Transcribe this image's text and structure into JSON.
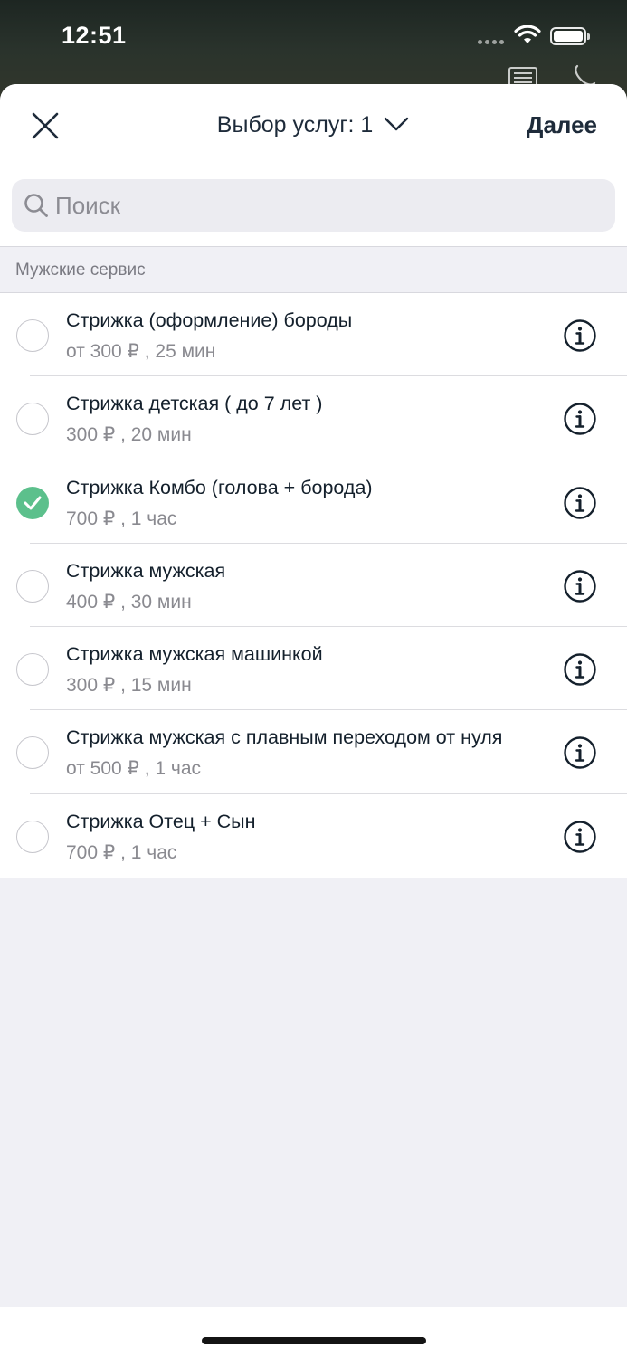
{
  "status_bar": {
    "time": "12:51"
  },
  "nav": {
    "title": "Выбор услуг: 1",
    "next_label": "Далее"
  },
  "search": {
    "placeholder": "Поиск",
    "value": ""
  },
  "section": {
    "title": "Мужские сервис"
  },
  "services": [
    {
      "name": "Стрижка (оформление) бороды",
      "details": "от 300 ₽ , 25 мин",
      "selected": false
    },
    {
      "name": "Стрижка детская ( до 7 лет )",
      "details": "300 ₽ , 20 мин",
      "selected": false
    },
    {
      "name": "Стрижка Комбо (голова + борода)",
      "details": "700 ₽ , 1 час",
      "selected": true
    },
    {
      "name": "Стрижка мужская",
      "details": "400 ₽ , 30 мин",
      "selected": false
    },
    {
      "name": "Стрижка мужская машинкой",
      "details": "300 ₽ , 15 мин",
      "selected": false
    },
    {
      "name": "Стрижка мужская с плавным переходом от нуля",
      "details": "от 500 ₽ , 1 час",
      "selected": false
    },
    {
      "name": "Стрижка Отец + Сын",
      "details": "700 ₽ , 1 час",
      "selected": false
    }
  ],
  "colors": {
    "accent_check": "#5cc08c",
    "text_primary": "#14202c",
    "text_secondary": "#8a8a90",
    "background": "#f0f0f5"
  },
  "icons": {
    "close": "close-icon",
    "title_chevron": "chevron-down-icon",
    "search": "search-icon",
    "info": "info-icon",
    "check": "checkmark-icon"
  }
}
